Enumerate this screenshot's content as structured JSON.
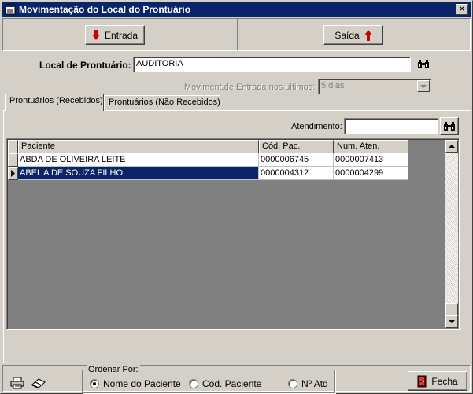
{
  "window": {
    "title": "Movimentação do Local do Prontuário",
    "close_glyph": "✕"
  },
  "toolbar": {
    "entrada_label": "Entrada",
    "saida_label": "Saída"
  },
  "form": {
    "local_label": "Local de Prontuário:",
    "local_value": "AUDITORIA",
    "moviment_label": "Moviment.de Entrada nos ultimos:",
    "moviment_value": "5 dias"
  },
  "tabs": [
    {
      "label": "Prontuários (Recebidos)",
      "active": true
    },
    {
      "label": "Prontuários (Não Recebidos)",
      "active": false
    }
  ],
  "search": {
    "atendimento_label": "Atendimento:",
    "atendimento_value": ""
  },
  "grid": {
    "columns": [
      "Paciente",
      "Cód. Pac.",
      "Num. Aten."
    ],
    "rows": [
      {
        "paciente": "ABDA DE OLIVEIRA LEITE",
        "cod_pac": "0000006745",
        "num_aten": "0000007413",
        "selected": false
      },
      {
        "paciente": "ABEL A DE SOUZA FILHO",
        "cod_pac": "0000004312",
        "num_aten": "0000004299",
        "selected": true
      }
    ]
  },
  "footer": {
    "order_title": "Ordenar Por:",
    "order_options": [
      {
        "label": "Nome do Paciente",
        "checked": true
      },
      {
        "label": "Cód. Paciente",
        "checked": false
      },
      {
        "label": "Nº Atd",
        "checked": false
      }
    ],
    "fecha_label": "Fecha"
  },
  "icons": {
    "app": "window-icon",
    "entrada": "arrow-down-icon",
    "saida": "arrow-up-icon",
    "search": "binoculars-icon",
    "print": "printer-icon",
    "eraser": "eraser-icon",
    "exit": "exit-door-icon"
  },
  "colors": {
    "titlebar": "#0a246a",
    "selection": "#0a246a",
    "arrow": "#cc0000",
    "face": "#d4d0c8"
  }
}
